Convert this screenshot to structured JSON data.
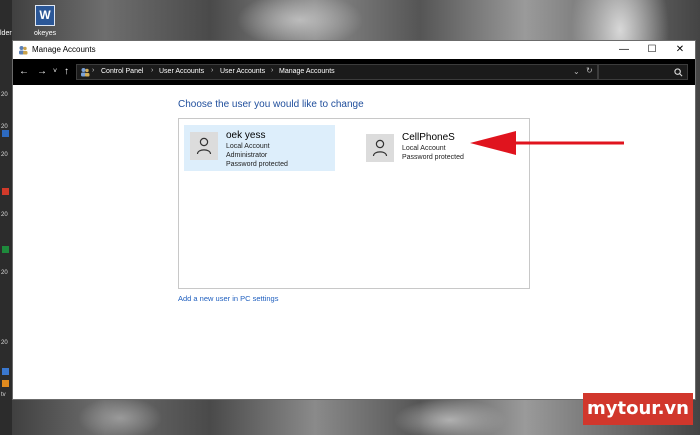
{
  "desktop": {
    "icon_label": "okeyes",
    "edge_label": "lder",
    "left_strip": [
      "20",
      "20",
      "20",
      "20",
      "20",
      "20",
      "tv"
    ]
  },
  "window": {
    "title": "Manage Accounts",
    "controls": {
      "minimize": "—",
      "maximize": "☐",
      "close": "✕"
    }
  },
  "address_bar": {
    "back": "←",
    "forward": "→",
    "dropdown": "˅",
    "up": "↑",
    "breadcrumbs": [
      "Control Panel",
      "User Accounts",
      "User Accounts",
      "Manage Accounts"
    ],
    "history_dropdown": "⌄",
    "refresh": "↻",
    "search_icon": "🔍"
  },
  "main": {
    "heading": "Choose the user you would like to change",
    "accounts": [
      {
        "name": "oek yess",
        "lines": [
          "Local Account",
          "Administrator",
          "Password protected"
        ],
        "selected": true
      },
      {
        "name": "CellPhoneS",
        "lines": [
          "Local Account",
          "Password protected"
        ],
        "selected": false
      }
    ],
    "add_user_link": "Add a new user in PC settings"
  },
  "annotation": {
    "arrow_color": "#e0141e"
  },
  "watermark": {
    "text": "mytour.vn"
  },
  "colors": {
    "heading": "#1f4e9c",
    "link": "#1f5fbf",
    "selected_bg": "#ddeefb"
  }
}
